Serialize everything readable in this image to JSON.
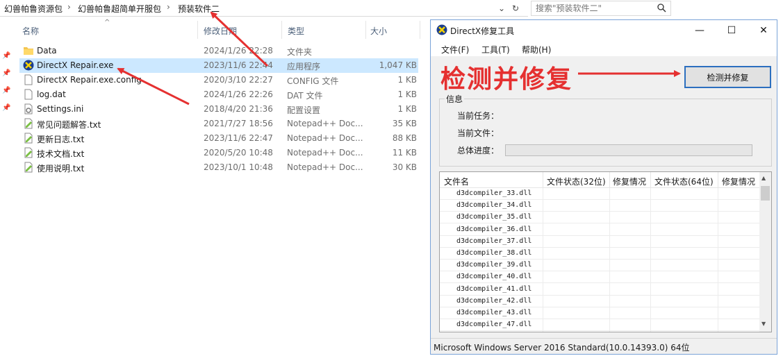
{
  "explorer": {
    "breadcrumb": [
      "幻兽帕鲁资源包",
      "幻兽帕鲁超简单开服包",
      "预装软件二"
    ],
    "search_placeholder": "搜索\"预装软件二\"",
    "columns": {
      "name": "名称",
      "date": "修改日期",
      "type": "类型",
      "size": "大小"
    },
    "files": [
      {
        "name": "Data",
        "date": "2024/1/26 22:28",
        "type": "文件夹",
        "size": "",
        "icon": "folder-icon"
      },
      {
        "name": "DirectX Repair.exe",
        "date": "2023/11/6 22:44",
        "type": "应用程序",
        "size": "1,047 KB",
        "icon": "directx-app-icon"
      },
      {
        "name": "DirectX Repair.exe.config",
        "date": "2020/3/10 22:27",
        "type": "CONFIG 文件",
        "size": "1 KB",
        "icon": "blank-file-icon"
      },
      {
        "name": "log.dat",
        "date": "2024/1/26 22:26",
        "type": "DAT 文件",
        "size": "1 KB",
        "icon": "blank-file-icon"
      },
      {
        "name": "Settings.ini",
        "date": "2018/4/20 21:36",
        "type": "配置设置",
        "size": "1 KB",
        "icon": "settings-file-icon"
      },
      {
        "name": "常见问题解答.txt",
        "date": "2021/7/27 18:56",
        "type": "Notepad++ Doc...",
        "size": "35 KB",
        "icon": "notepadpp-file-icon"
      },
      {
        "name": "更新日志.txt",
        "date": "2023/11/6 22:47",
        "type": "Notepad++ Doc...",
        "size": "88 KB",
        "icon": "notepadpp-file-icon"
      },
      {
        "name": "技术文档.txt",
        "date": "2020/5/20 10:48",
        "type": "Notepad++ Doc...",
        "size": "11 KB",
        "icon": "notepadpp-file-icon"
      },
      {
        "name": "使用说明.txt",
        "date": "2023/10/1 10:48",
        "type": "Notepad++ Doc...",
        "size": "30 KB",
        "icon": "notepadpp-file-icon"
      }
    ]
  },
  "dx_window": {
    "title": "DirectX修复工具",
    "menu": [
      "文件(F)",
      "工具(T)",
      "帮助(H)"
    ],
    "annotation": "检测并修复",
    "scan_button": "检测并修复",
    "info_title": "信息",
    "info_labels": [
      "当前任务：",
      "当前文件：",
      "总体进度："
    ],
    "progress": 0,
    "list_headers": [
      "文件名",
      "文件状态(32位)",
      "修复情况",
      "文件状态(64位)",
      "修复情况"
    ],
    "list_rows": [
      "d3dcompiler_33.dll",
      "d3dcompiler_34.dll",
      "d3dcompiler_35.dll",
      "d3dcompiler_36.dll",
      "d3dcompiler_37.dll",
      "d3dcompiler_38.dll",
      "d3dcompiler_39.dll",
      "d3dcompiler_40.dll",
      "d3dcompiler_41.dll",
      "d3dcompiler_42.dll",
      "d3dcompiler_43.dll",
      "d3dcompiler_47.dll"
    ],
    "status_bar": "Microsoft Windows Server 2016 Standard(10.0.14393.0) 64位"
  },
  "colors": {
    "accent_red": "#e53030",
    "selection": "#cce8ff",
    "button_border": "#2c6fbf"
  }
}
